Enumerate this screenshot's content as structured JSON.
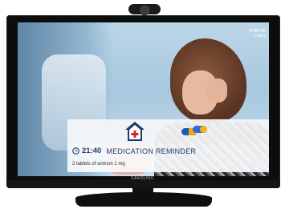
{
  "tv": {
    "brand": "SAMSUNG"
  },
  "broadcast": {
    "logo": "VIVIR DE",
    "logo_sub": "Cuatro"
  },
  "notification": {
    "time": "21:40",
    "title": "MEDICATION REMINDER",
    "detail": "2 tablets of sintrom 1 mg",
    "icons": [
      "house-care-logo-icon",
      "pills-icon",
      "clock-icon"
    ]
  },
  "colors": {
    "accent": "#1f3a6b"
  }
}
